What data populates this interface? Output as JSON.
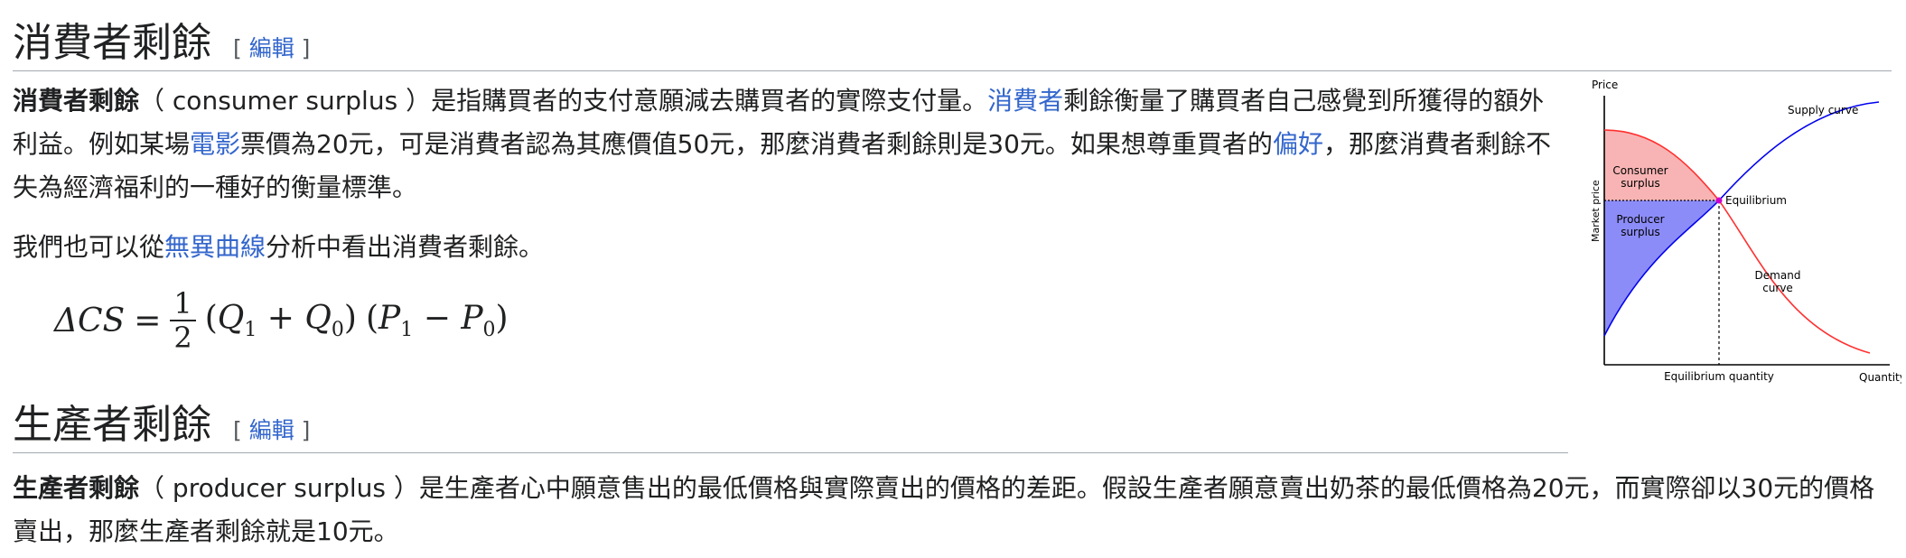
{
  "sections": [
    {
      "title": "消費者剩餘",
      "edit_open": "[ ",
      "edit_label": "編輯",
      "edit_close": " ]"
    },
    {
      "title": "生產者剩餘",
      "edit_open": "[ ",
      "edit_label": "編輯",
      "edit_close": " ]"
    }
  ],
  "p1": {
    "bold": "消費者剩餘",
    "t1": "（ consumer surplus ）是指購買者的支付意願減去購買者的實際支付量。",
    "link1": "消費者",
    "t2": "剩餘衡量了購買者自己感覺到所獲得的額外利益。例如某場",
    "link2": "電影",
    "t3": "票價為20元，可是消費者認為其應價值50元，那麼消費者剩餘則是30元。如果想尊重買者的",
    "link3": "偏好",
    "t4": "，那麼消費者剩餘不失為經濟福利的一種好的衡量標準。"
  },
  "p2": {
    "t1": "我們也可以從",
    "link1": "無異曲線",
    "t2": "分析中看出消費者剩餘。"
  },
  "formula": {
    "lhs": "ΔCS",
    "eq": "=",
    "num": "1",
    "den": "2",
    "q1": "Q",
    "q1_sub": "1",
    "plus": "+",
    "q0": "Q",
    "q0_sub": "0",
    "p1": "P",
    "p1_sub": "1",
    "minus": "−",
    "p0": "P",
    "p0_sub": "0"
  },
  "p3": {
    "bold": "生產者剩餘",
    "t1": "（ producer surplus ）是生產者心中願意售出的最低價格與實際賣出的價格的差距。假設生產者願意賣出奶茶的最低價格為20元，而實際卻以30元的價格賣出，那麼生產者剩餘就是10元。"
  },
  "figure": {
    "price_label": "Price",
    "quantity_label": "Quantity",
    "market_price_label": "Market price",
    "eq_quantity_label": "Equilibrium quantity",
    "equilibrium_label": "Equilibrium",
    "supply_label": "Supply curve",
    "demand_label_1": "Demand",
    "demand_label_2": "curve",
    "consumer_1": "Consumer",
    "consumer_2": "surplus",
    "producer_1": "Producer",
    "producer_2": "surplus",
    "colors": {
      "supply": "#0000ee",
      "demand": "#ff3030",
      "consumer_fill": "#f8b4b4",
      "producer_fill": "#8c8cf8",
      "equilibrium": "#cc00cc"
    }
  }
}
